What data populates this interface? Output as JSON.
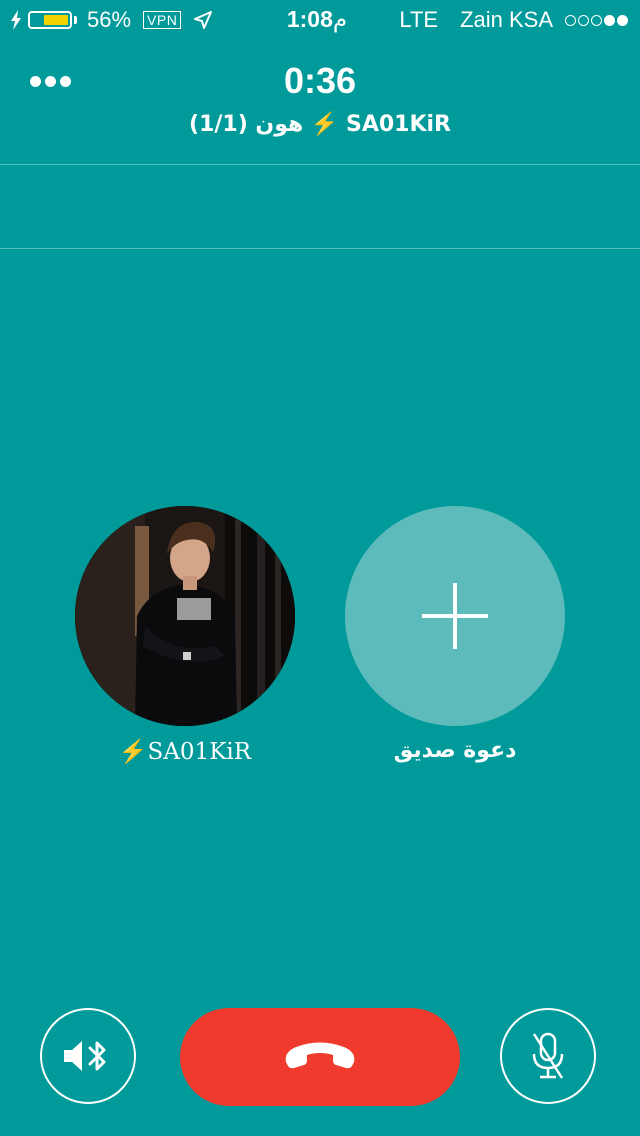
{
  "status_bar": {
    "battery_percent": "56%",
    "battery_level": 0.56,
    "vpn": "VPN",
    "time": "1:08",
    "time_suffix": "م",
    "network": "LTE",
    "carrier": "Zain KSA",
    "signal_strength": "2 of 5"
  },
  "call": {
    "duration": "0:36",
    "subtitle": "SA01KiR ⚡️ هون (1/1)"
  },
  "participants": [
    {
      "name": "⚡️SA01KiR",
      "avatar": "profile-photo"
    }
  ],
  "invite": {
    "label": "دعوة صديق",
    "icon": "plus-icon"
  },
  "controls": {
    "speaker_icon": "speaker-bluetooth-icon",
    "end_call_icon": "phone-hangup-icon",
    "mute_icon": "mic-muted-icon"
  },
  "colors": {
    "background": "#009a9a",
    "invite_circle": "#5ebbbb",
    "end_call": "#f03a2e",
    "battery_fill": "#f5d300"
  }
}
